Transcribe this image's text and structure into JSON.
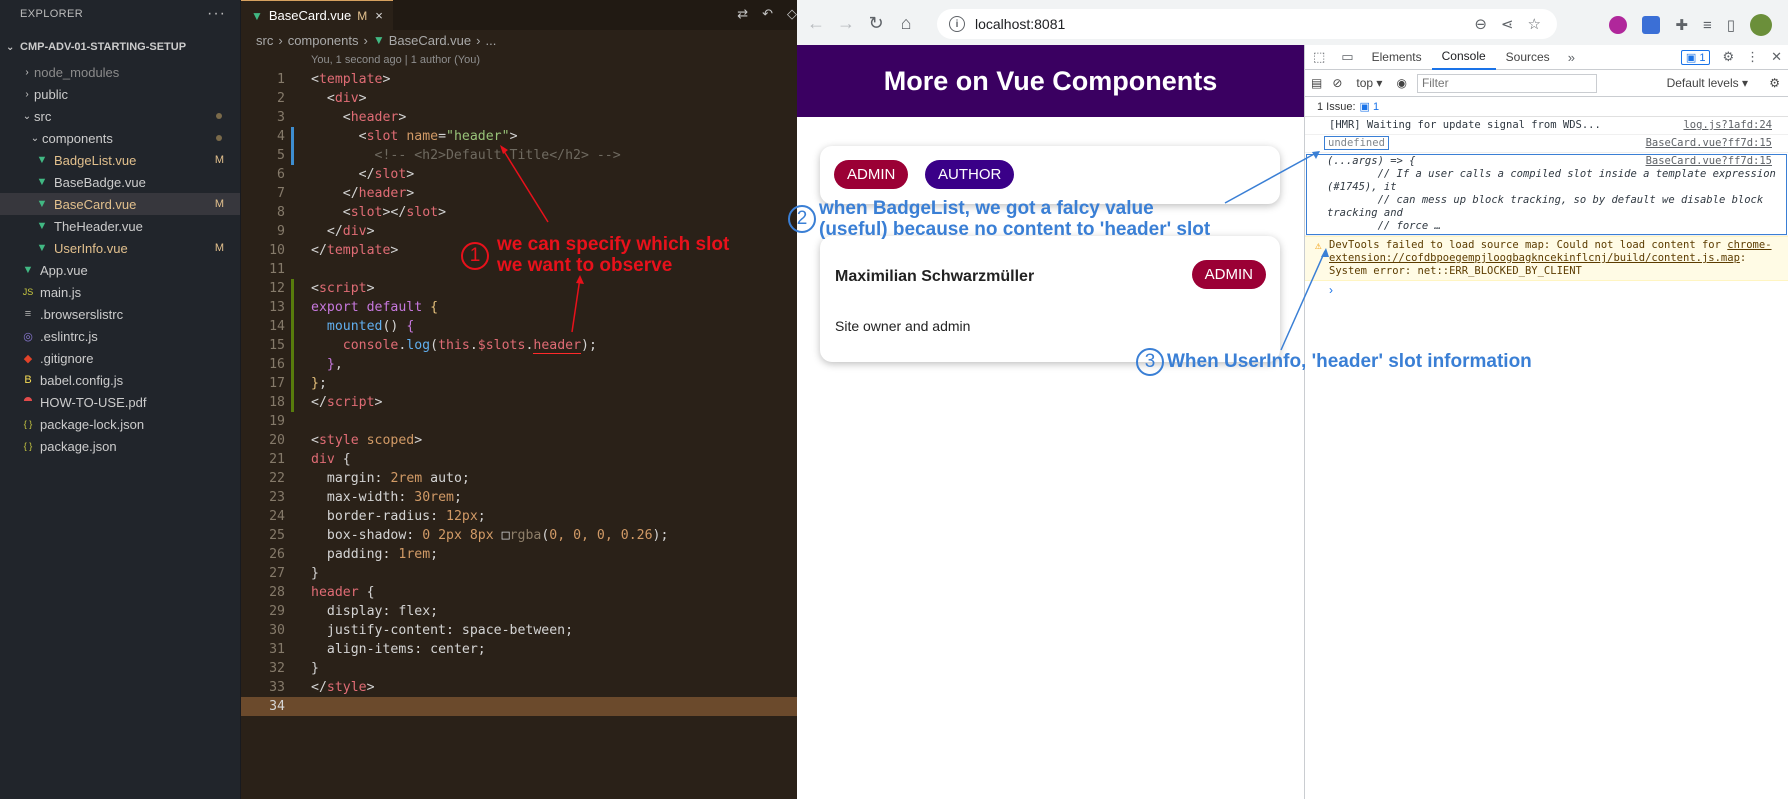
{
  "explorer": {
    "title": "EXPLORER",
    "more": "···",
    "project": "CMP-ADV-01-STARTING-SETUP",
    "items": [
      {
        "label": "node_modules",
        "chev": "›",
        "icon": "",
        "muted": true
      },
      {
        "label": "public",
        "chev": "›",
        "icon": ""
      },
      {
        "label": "src",
        "chev": "⌄",
        "icon": "",
        "dot": true
      },
      {
        "label": "components",
        "chev": "⌄",
        "icon": "",
        "dot": true
      },
      {
        "label": "BadgeList.vue",
        "icon": "vue",
        "badge": "M"
      },
      {
        "label": "BaseBadge.vue",
        "icon": "vue"
      },
      {
        "label": "BaseCard.vue",
        "icon": "vue",
        "badge": "M",
        "active": true
      },
      {
        "label": "TheHeader.vue",
        "icon": "vue"
      },
      {
        "label": "UserInfo.vue",
        "icon": "vue",
        "badge": "M"
      },
      {
        "label": "App.vue",
        "icon": "vue"
      },
      {
        "label": "main.js",
        "icon": "js"
      },
      {
        "label": ".browserslistrc",
        "icon": "list"
      },
      {
        "label": ".eslintrc.js",
        "icon": "eslint"
      },
      {
        "label": ".gitignore",
        "icon": "git"
      },
      {
        "label": "babel.config.js",
        "icon": "babel"
      },
      {
        "label": "HOW-TO-USE.pdf",
        "icon": "pdf"
      },
      {
        "label": "package-lock.json",
        "icon": "json"
      },
      {
        "label": "package.json",
        "icon": "json"
      }
    ]
  },
  "editor": {
    "tab_label": "BaseCard.vue",
    "tab_modified": "M",
    "tab_close": "×",
    "breadcrumb": [
      "src",
      "components",
      "BaseCard.vue",
      "..."
    ],
    "blame": "You, 1 second ago | 1 author (You)",
    "line_numbers": [
      "1",
      "2",
      "3",
      "4",
      "5",
      "6",
      "7",
      "8",
      "9",
      "10",
      "11",
      "12",
      "13",
      "14",
      "15",
      "16",
      "17",
      "18",
      "19",
      "20",
      "21",
      "22",
      "23",
      "24",
      "25",
      "26",
      "27",
      "28",
      "29",
      "30",
      "31",
      "32",
      "33",
      "34"
    ]
  },
  "browser": {
    "url": "localhost:8081",
    "page_title": "More on Vue Components",
    "badges": [
      "ADMIN",
      "AUTHOR"
    ],
    "user": {
      "name": "Maximilian Schwarzmüller",
      "role": "ADMIN",
      "description": "Site owner and admin"
    },
    "colors": {
      "header": "#3a0061",
      "admin": "#9b0035",
      "author": "#3a0088"
    }
  },
  "devtools": {
    "tabs": [
      "Elements",
      "Console",
      "Sources"
    ],
    "active_tab": "Console",
    "issues_chip": "1",
    "context": "top",
    "filter_placeholder": "Filter",
    "levels": "Default levels",
    "issue_bar_label": "1 Issue:",
    "issue_bar_count": "1",
    "console": {
      "hmr": "[HMR] Waiting for update signal from WDS...",
      "hmr_src": "log.js?1afd:24",
      "undefined": "undefined",
      "undefined_src": "BaseCard.vue?ff7d:15",
      "fn_src": "BaseCard.vue?ff7d:15",
      "fn_body": "(...args) => {\n        // If a user calls a compiled slot inside a template expression (#1745), it\n        // can mess up block tracking, so by default we disable block tracking and\n        // force …",
      "warn_text": "DevTools failed to load source map: Could not load content for ",
      "warn_link": "chrome-extension://cofdbpoegempjloogbagkncekinflcnj/build/content.js.map",
      "warn_tail": ": System error: net::ERR_BLOCKED_BY_CLIENT",
      "prompt": "›"
    }
  },
  "annotations": {
    "a1_num": "1",
    "a1_line1": "we can specify which slot",
    "a1_line2": "we want to observe",
    "a2_num": "2",
    "a2_line1": "when BadgeList, we got a falcy value",
    "a2_line2": "(useful) because no content to 'header' slot",
    "a3_num": "3",
    "a3_text": "When UserInfo, 'header' slot information"
  }
}
